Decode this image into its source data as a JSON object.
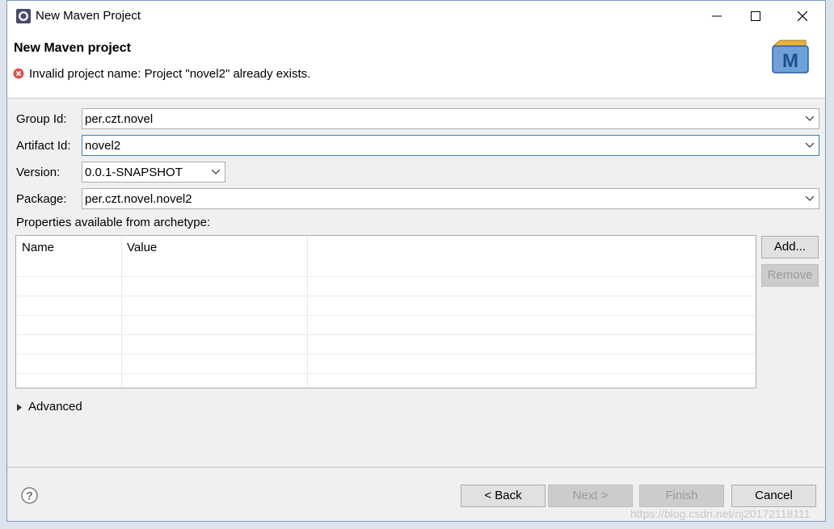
{
  "window": {
    "title": "New Maven Project"
  },
  "header": {
    "title": "New Maven project",
    "error_message": "Invalid project name: Project \"novel2\" already exists."
  },
  "form": {
    "group_id": {
      "label": "Group Id:",
      "value": "per.czt.novel"
    },
    "artifact_id": {
      "label": "Artifact Id:",
      "value": "novel2"
    },
    "version": {
      "label": "Version:",
      "value": "0.0.1-SNAPSHOT"
    },
    "package": {
      "label": "Package:",
      "value": "per.czt.novel.novel2"
    }
  },
  "properties": {
    "label": "Properties available from archetype:",
    "columns": [
      "Name",
      "Value"
    ],
    "rows": [],
    "add_label": "Add...",
    "remove_label": "Remove"
  },
  "advanced": {
    "label": "Advanced"
  },
  "buttons": {
    "back": "< Back",
    "next": "Next >",
    "finish": "Finish",
    "cancel": "Cancel"
  },
  "watermark": "https://blog.csdn.net/nj20172118111",
  "colors": {
    "error": "#d9534f",
    "focus_border": "#3c7fb1",
    "maven_blue": "#2b5fa8"
  }
}
